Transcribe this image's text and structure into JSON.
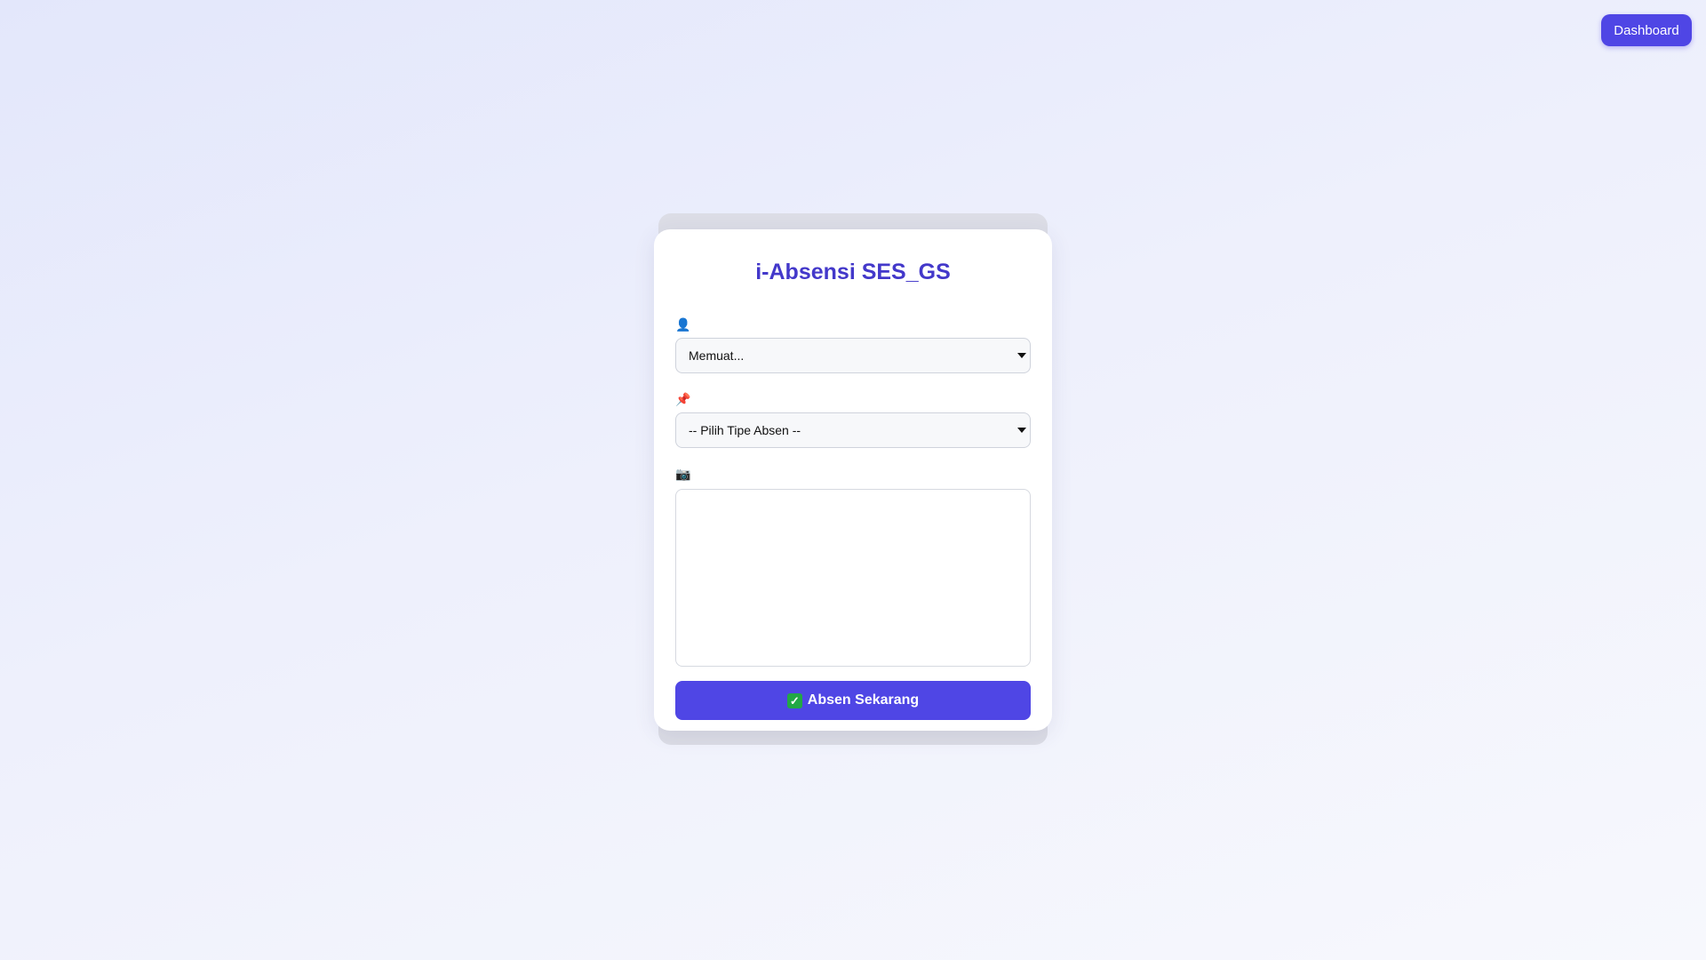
{
  "header": {
    "dashboard_label": "Dashboard"
  },
  "form": {
    "title": "i-Absensi SES_GS",
    "user_icon": "👤",
    "user_select_value": "Memuat...",
    "type_icon": "📌",
    "type_select_value": "-- Pilih Tipe Absen --",
    "camera_icon": "📷",
    "submit_icon": "✓",
    "submit_label": "Absen Sekarang"
  },
  "colors": {
    "accent": "#4f46e5",
    "title": "#4338ca",
    "check": "#22a845"
  }
}
